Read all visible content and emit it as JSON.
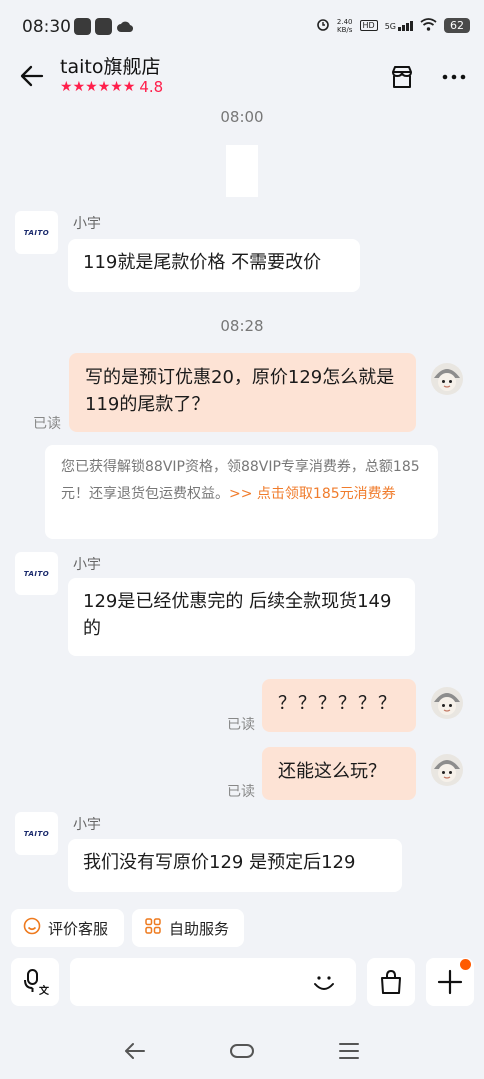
{
  "status_bar": {
    "time": "08:30",
    "net_speed_value": "2.40",
    "net_speed_unit": "KB/s",
    "hd": "HD",
    "network": "5G",
    "battery": "62"
  },
  "header": {
    "shop_name": "taito旗舰店",
    "stars": [
      "★",
      "★",
      "★",
      "★",
      "★",
      "★"
    ],
    "rating": "4.8"
  },
  "shop_logo_text": "TAITO",
  "messages": {
    "time1": "08:00",
    "sender_1": "小宇",
    "msg_1": "119就是尾款价格 不需要改价",
    "time2": "08:28",
    "out_1": "写的是预订优惠20，原价129怎么就是119的尾款了？",
    "read_1": "已读",
    "notice_text": "您已获得解锁88VIP资格，领88VIP专享消费券，总额185元！还享退货包运费权益。",
    "notice_link": ">> 点击领取185元消费券",
    "sender_2": "小宇",
    "msg_2": "129是已经优惠完的 后续全款现货149的",
    "out_2": "？？？？？？",
    "read_2": "已读",
    "out_3": "还能这么玩？",
    "read_3": "已读",
    "sender_3": "小宇",
    "msg_3": "我们没有写原价129  是预定后129"
  },
  "quick_actions": {
    "rate_service": "评价客服",
    "self_service": "自助服务"
  },
  "input": {
    "voice_label": "文"
  },
  "colors": {
    "accent": "#ff1f4b",
    "outgoing_bubble": "#fde3d5",
    "link": "#f07c2c",
    "badge_dot": "#ff5a00"
  },
  "icons": [
    "back-arrow-icon",
    "shop-icon",
    "more-icon",
    "voice-icon",
    "emoji-icon",
    "shopping-bag-icon",
    "plus-icon",
    "smile-face-icon",
    "grid-icon",
    "nav-back-icon",
    "nav-home-icon",
    "nav-menu-icon"
  ]
}
